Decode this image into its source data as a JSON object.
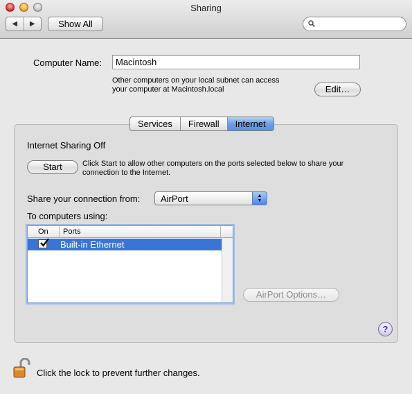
{
  "window": {
    "title": "Sharing"
  },
  "toolbar": {
    "back_icon": "◀",
    "forward_icon": "▶",
    "show_all_label": "Show All",
    "search": {
      "value": "",
      "placeholder": ""
    }
  },
  "computer": {
    "name_label": "Computer Name:",
    "name_value": "Macintosh",
    "info_line1": "Other computers on your local subnet can access",
    "info_line2": "your computer at Macintosh.local",
    "edit_label": "Edit…"
  },
  "tabs": [
    {
      "label": "Services",
      "active": false
    },
    {
      "label": "Firewall",
      "active": false
    },
    {
      "label": "Internet",
      "active": true
    }
  ],
  "internet": {
    "status": "Internet Sharing Off",
    "start_label": "Start",
    "start_desc_line1": "Click Start to allow other computers on the ports selected below to share your",
    "start_desc_line2": "connection to the Internet.",
    "share_from_label": "Share your connection from:",
    "share_from_value": "AirPort",
    "to_computers_label": "To computers using:",
    "list": {
      "columns": [
        "On",
        "Ports"
      ],
      "rows": [
        {
          "on": true,
          "port": "Built-in Ethernet"
        }
      ]
    },
    "airport_options_label": "AirPort Options…"
  },
  "help_label": "?",
  "lock": {
    "text": "Click the lock to prevent further changes."
  }
}
